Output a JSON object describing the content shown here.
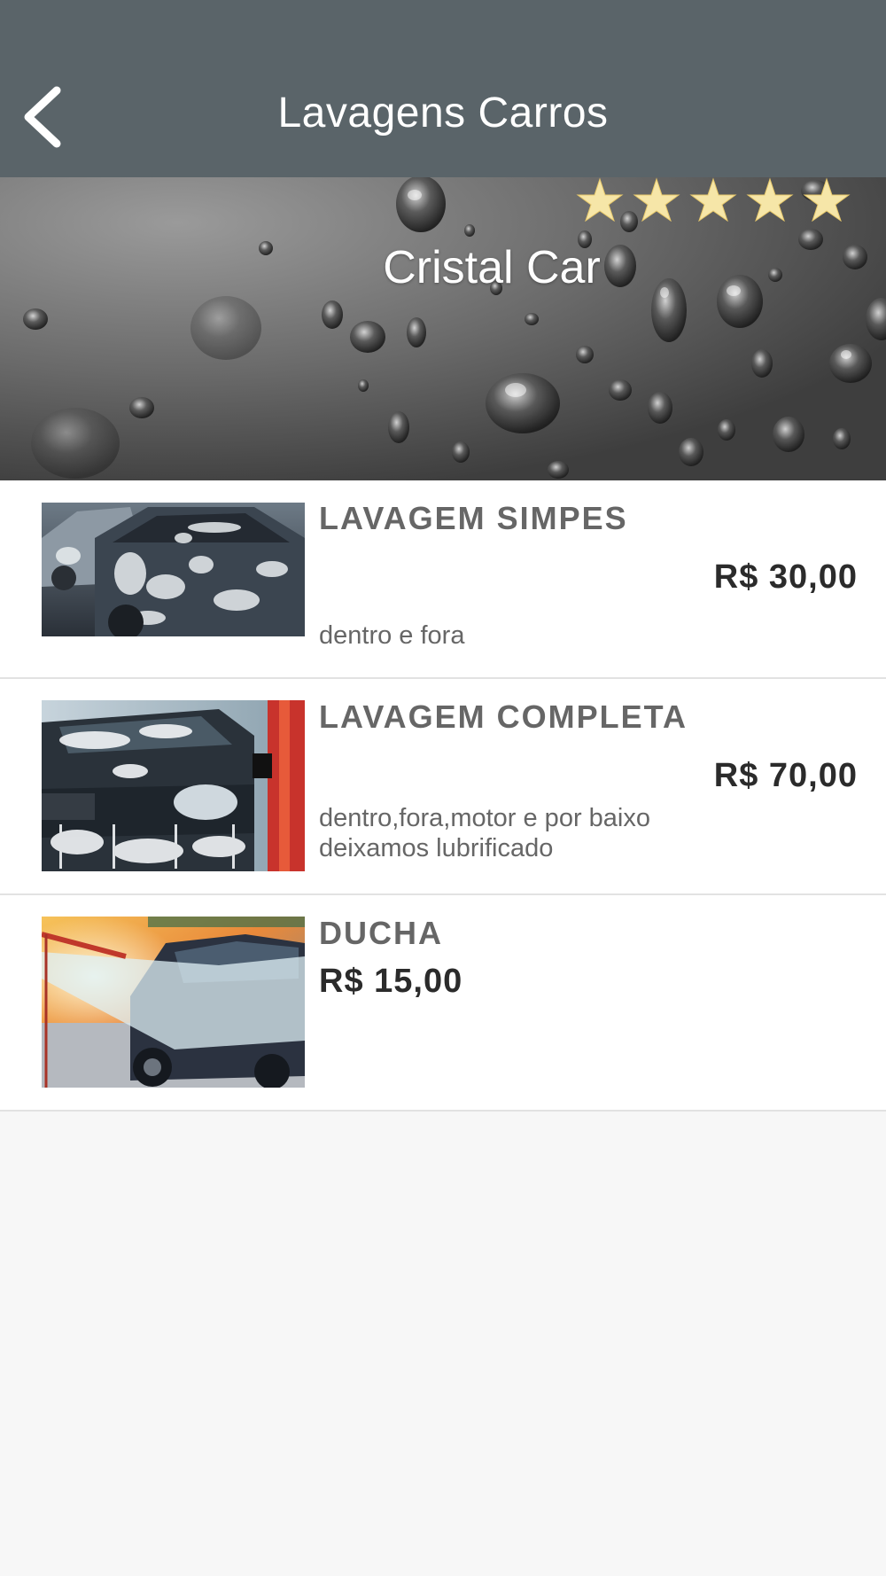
{
  "header": {
    "title": "Lavagens Carros",
    "back_icon": "chevron-left-icon"
  },
  "banner": {
    "title": "Cristal Car",
    "rating": 5,
    "rating_max": 5,
    "star_color": "#f6e6a8"
  },
  "services": [
    {
      "title": "LAVAGEM SIMPES",
      "price": "R$ 30,00",
      "description": "dentro e fora"
    },
    {
      "title": "LAVAGEM COMPLETA",
      "price": "R$ 70,00",
      "description_lines": [
        "dentro,fora,motor e por baixo",
        "deixamos lubrificado"
      ]
    },
    {
      "title": "DUCHA",
      "price": "R$ 15,00"
    }
  ],
  "colors": {
    "header_bg": "#5a6469",
    "page_bg": "#f7f7f7",
    "title_text": "#666666",
    "price_text": "#2b2b2b"
  }
}
